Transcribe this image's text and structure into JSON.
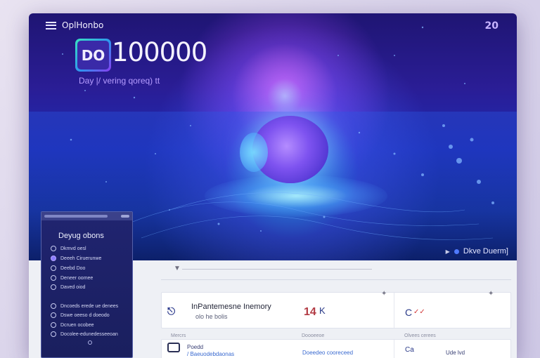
{
  "header": {
    "brand_name": "OplHonbo",
    "corner_badge": "20",
    "logo_text": "DO",
    "headline_number": "100000",
    "tagline": "Day |/ vering qoreq) tt"
  },
  "hero_footer": {
    "label": "Dkve Duerm]"
  },
  "sidebar": {
    "title": "Deyug obons",
    "items": [
      {
        "label": "Dkmvd oesl",
        "filled": false
      },
      {
        "label": "Deeeh Ciruerunwe",
        "filled": true
      },
      {
        "label": "Deebd Doo",
        "filled": false
      },
      {
        "label": "Deneer oomee",
        "filled": false
      },
      {
        "label": "Daved oiod",
        "filled": false
      },
      {
        "label": "Dncoeds erede ue denees",
        "filled": false
      },
      {
        "label": "Dswe oeeso d doeodo",
        "filled": false
      },
      {
        "label": "Dcruen ocobee",
        "filled": false
      },
      {
        "label": "Docolee-edunedesseeoan",
        "filled": false
      }
    ]
  },
  "card": {
    "title": "InPantemesne Inemory",
    "subtitle": "olo he bolis",
    "stat": "14",
    "stat_suffix": "K",
    "mark": "C",
    "sub_labels": [
      "Mercrs",
      "Doooeeoe",
      "Olvees cerees"
    ]
  },
  "card2": {
    "line1": "Poedd",
    "line2": "/ Baeuodebdaonas",
    "line3": "Doeedeo cooreceed",
    "mark": "Ca",
    "line5": "Ude lvd"
  },
  "colors": {
    "accent": "#4f7aff",
    "hero_top": "#1f1573",
    "sidebar_bg": "#202470",
    "stat_red": "#b23b44"
  }
}
